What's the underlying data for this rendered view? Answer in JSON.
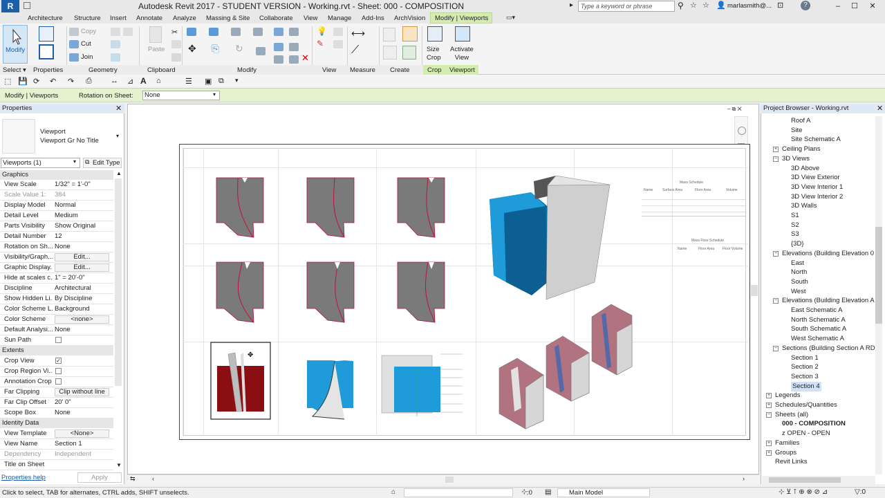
{
  "title_bar": {
    "logo": "R",
    "title": "Autodesk Revit 2017 - STUDENT VERSION -     Working.rvt - Sheet: 000 - COMPOSITION",
    "search_placeholder": "Type a keyword or phrase",
    "user": "marlasmith@...",
    "help": "?"
  },
  "tabs": [
    "Architecture",
    "Structure",
    "Insert",
    "Annotate",
    "Analyze",
    "Massing & Site",
    "Collaborate",
    "View",
    "Manage",
    "Add-Ins",
    "ArchVision",
    "Modify | Viewports"
  ],
  "ribbon": {
    "modify_label": "Modify",
    "clipboard_items": {
      "copy": "Copy",
      "cut": "Cut",
      "join": "Join",
      "paste": "Paste"
    },
    "crop_tools": {
      "size_crop": "Size\nCrop",
      "activate_view": "Activate\nView"
    },
    "panels": [
      "Select ▾",
      "Properties",
      "Geometry",
      "Clipboard",
      "Modify",
      "View",
      "Measure",
      "Create",
      "Crop",
      "Viewport"
    ]
  },
  "options_bar": {
    "context": "Modify | Viewports",
    "rotation_label": "Rotation on Sheet:",
    "rotation_value": "None"
  },
  "properties": {
    "header": "Properties",
    "type_name": "Viewport",
    "type_sub": "Viewport Gr No Title",
    "selector": "Viewports (1)",
    "edit_type": "Edit Type",
    "groups": {
      "graphics": "Graphics",
      "extents": "Extents",
      "identity": "Identity Data"
    },
    "rows": [
      {
        "name": "View Scale",
        "value": "1/32\" = 1'-0\""
      },
      {
        "name": "Scale Value  1:",
        "value": "384"
      },
      {
        "name": "Display Model",
        "value": "Normal"
      },
      {
        "name": "Detail Level",
        "value": "Medium"
      },
      {
        "name": "Parts Visibility",
        "value": "Show Original"
      },
      {
        "name": "Detail Number",
        "value": "12"
      },
      {
        "name": "Rotation on Sh...",
        "value": "None"
      },
      {
        "name": "Visibility/Graph...",
        "value": "Edit..."
      },
      {
        "name": "Graphic Display...",
        "value": "Edit..."
      },
      {
        "name": "Hide at scales c...",
        "value": "1\" = 20'-0\""
      },
      {
        "name": "Discipline",
        "value": "Architectural"
      },
      {
        "name": "Show Hidden Li...",
        "value": "By Discipline"
      },
      {
        "name": "Color Scheme L...",
        "value": "Background"
      },
      {
        "name": "Color Scheme",
        "value": "<none>"
      },
      {
        "name": "Default Analysi...",
        "value": "None"
      },
      {
        "name": "Sun Path",
        "value": ""
      }
    ],
    "extents_rows": [
      {
        "name": "Crop View",
        "value": "✓"
      },
      {
        "name": "Crop Region Vi...",
        "value": ""
      },
      {
        "name": "Annotation Crop",
        "value": ""
      },
      {
        "name": "Far Clipping",
        "value": "Clip without line"
      },
      {
        "name": "Far Clip Offset",
        "value": "20'  0\""
      },
      {
        "name": "Scope Box",
        "value": "None"
      }
    ],
    "identity_rows": [
      {
        "name": "View Template",
        "value": "<None>"
      },
      {
        "name": "View Name",
        "value": "Section 1"
      },
      {
        "name": "Dependency",
        "value": "Independent"
      },
      {
        "name": "Title on Sheet",
        "value": ""
      }
    ],
    "help_link": "Properties help",
    "apply": "Apply"
  },
  "schedule": {
    "title1": "Mass Schedule",
    "cols1": [
      "Name",
      "Surface Area",
      "Floor Area",
      "Volume"
    ],
    "title2": "Mass Floor Schedule",
    "cols2": [
      "Name",
      "Floor Area",
      "Floor Volume"
    ]
  },
  "browser": {
    "header": "Project Browser - Working.rvt",
    "items": [
      {
        "label": "Roof A",
        "indent": 3,
        "toggle": ""
      },
      {
        "label": "Site",
        "indent": 3,
        "toggle": ""
      },
      {
        "label": "Site Schematic A",
        "indent": 3,
        "toggle": ""
      },
      {
        "label": "Ceiling Plans",
        "indent": 2,
        "toggle": "+"
      },
      {
        "label": "3D Views",
        "indent": 2,
        "toggle": "−"
      },
      {
        "label": "3D Above",
        "indent": 3,
        "toggle": ""
      },
      {
        "label": "3D View Exterior",
        "indent": 3,
        "toggle": ""
      },
      {
        "label": "3D View Interior 1",
        "indent": 3,
        "toggle": ""
      },
      {
        "label": "3D View Interior 2",
        "indent": 3,
        "toggle": ""
      },
      {
        "label": "3D Walls",
        "indent": 3,
        "toggle": ""
      },
      {
        "label": "S1",
        "indent": 3,
        "toggle": ""
      },
      {
        "label": "S2",
        "indent": 3,
        "toggle": ""
      },
      {
        "label": "S3",
        "indent": 3,
        "toggle": ""
      },
      {
        "label": "{3D}",
        "indent": 3,
        "toggle": ""
      },
      {
        "label": "Elevations (Building Elevation 0",
        "indent": 2,
        "toggle": "−"
      },
      {
        "label": "East",
        "indent": 3,
        "toggle": ""
      },
      {
        "label": "North",
        "indent": 3,
        "toggle": ""
      },
      {
        "label": "South",
        "indent": 3,
        "toggle": ""
      },
      {
        "label": "West",
        "indent": 3,
        "toggle": ""
      },
      {
        "label": "Elevations (Building Elevation A",
        "indent": 2,
        "toggle": "−"
      },
      {
        "label": "East Schematic A",
        "indent": 3,
        "toggle": ""
      },
      {
        "label": "North Schematic A",
        "indent": 3,
        "toggle": ""
      },
      {
        "label": "South Schematic A",
        "indent": 3,
        "toggle": ""
      },
      {
        "label": "West Schematic A",
        "indent": 3,
        "toggle": ""
      },
      {
        "label": "Sections (Building Section A RD",
        "indent": 2,
        "toggle": "−"
      },
      {
        "label": "Section 1",
        "indent": 3,
        "toggle": ""
      },
      {
        "label": "Section 2",
        "indent": 3,
        "toggle": ""
      },
      {
        "label": "Section 3",
        "indent": 3,
        "toggle": ""
      },
      {
        "label": "Section 4",
        "indent": 3,
        "toggle": "",
        "selected": true
      },
      {
        "label": "Legends",
        "indent": 1,
        "toggle": "+"
      },
      {
        "label": "Schedules/Quantities",
        "indent": 1,
        "toggle": "+"
      },
      {
        "label": "Sheets (all)",
        "indent": 1,
        "toggle": "−"
      },
      {
        "label": "000 - COMPOSITION",
        "indent": 2,
        "toggle": "",
        "bold": true
      },
      {
        "label": "z OPEN - OPEN",
        "indent": 2,
        "toggle": ""
      },
      {
        "label": "Families",
        "indent": 1,
        "toggle": "+"
      },
      {
        "label": "Groups",
        "indent": 1,
        "toggle": "+"
      },
      {
        "label": "Revit Links",
        "indent": 1,
        "toggle": ""
      }
    ]
  },
  "status": {
    "message": "Click to select, TAB for alternates, CTRL adds, SHIFT unselects.",
    "zero": ":0",
    "model": "Main Model"
  },
  "colors": {
    "accent_green": "#d5ecb1",
    "selection_blue": "#1b5fa8",
    "section_red": "#8b0e12",
    "blue_face": "#1e9bd8"
  }
}
